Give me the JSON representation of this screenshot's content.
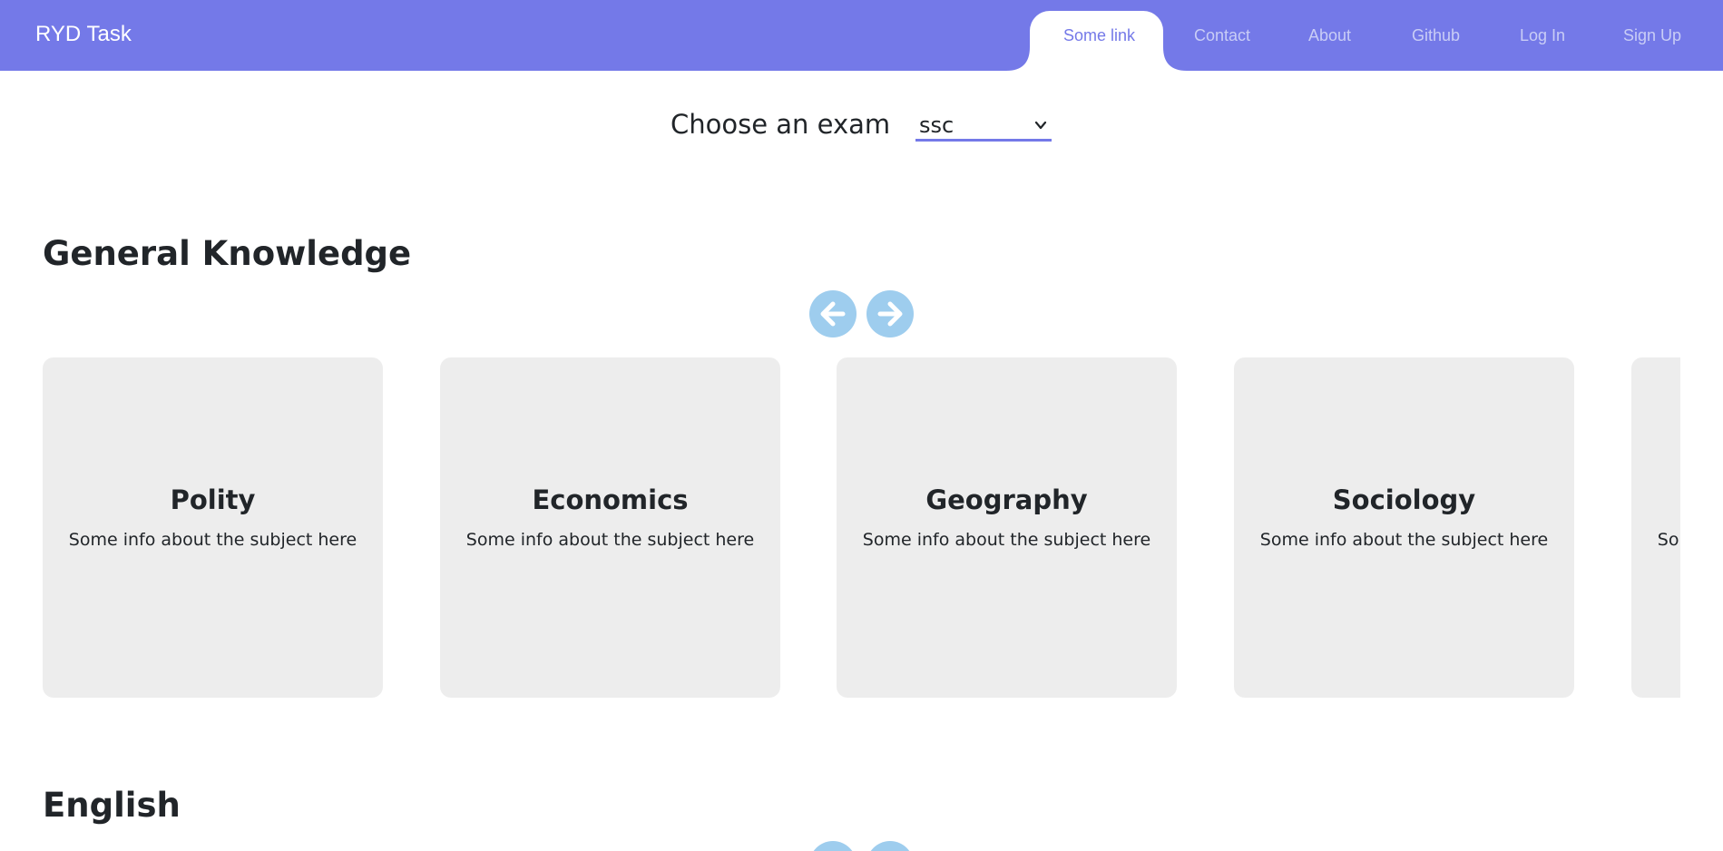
{
  "navbar": {
    "brand": "RYD Task",
    "links": [
      {
        "label": "Some link",
        "active": true
      },
      {
        "label": "Contact",
        "active": false
      },
      {
        "label": "About",
        "active": false
      },
      {
        "label": "Github",
        "active": false
      },
      {
        "label": "Log In",
        "active": false
      },
      {
        "label": "Sign Up",
        "active": false
      }
    ],
    "bg_color": "#7479e8"
  },
  "exam": {
    "label": "Choose an exam",
    "selected": "ssc"
  },
  "sections": [
    {
      "title": "General Knowledge",
      "controls": {
        "prev_icon": "arrow-left-icon",
        "next_icon": "arrow-right-icon"
      },
      "cards": [
        {
          "title": "Polity",
          "info": "Some info about the subject here"
        },
        {
          "title": "Economics",
          "info": "Some info about the subject here"
        },
        {
          "title": "Geography",
          "info": "Some info about the subject here"
        },
        {
          "title": "Sociology",
          "info": "Some info about the subject here"
        },
        {
          "title": "",
          "info": "Some info about the subject here"
        }
      ]
    },
    {
      "title": "English"
    }
  ],
  "colors": {
    "accent": "#7479e8",
    "arrow_button": "#9ecdee",
    "card_bg": "#ededed"
  }
}
